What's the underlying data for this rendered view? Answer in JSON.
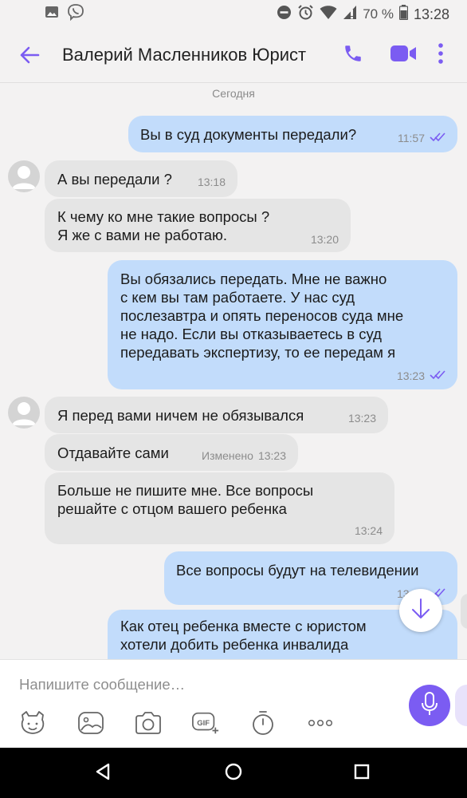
{
  "status_bar": {
    "battery_percent": "70 %",
    "time": "13:28",
    "icons": [
      "gallery-icon",
      "viber-icon",
      "do-not-disturb-icon",
      "alarm-icon",
      "wifi-icon",
      "signal-icon",
      "battery-icon"
    ]
  },
  "header": {
    "contact_name": "Валерий Масленников Юрист",
    "icons": [
      "back-arrow-icon",
      "phone-icon",
      "video-icon",
      "more-vertical-icon"
    ],
    "accent_color": "#7b5cf2"
  },
  "chat": {
    "date_separator": "Сегодня",
    "messages": [
      {
        "direction": "out",
        "text": "Вы в суд документы передали?",
        "time": "11:57",
        "read": true
      },
      {
        "direction": "in",
        "text": "А вы передали ?",
        "time": "13:18",
        "avatar": true
      },
      {
        "direction": "in",
        "text": "К чему ко мне такие вопросы ?\nЯ же с вами не работаю.",
        "time": "13:20"
      },
      {
        "direction": "out",
        "text": "Вы обязались передать. Мне не важно\nс кем вы там работаете. У нас суд\nпослезавтра и опять переносов суда мне\nне надо. Если вы отказываетесь в суд\nпередавать экспертизу, то ее передам я",
        "time": "13:23",
        "read": true
      },
      {
        "direction": "in",
        "text": "Я перед вами ничем не обязывался",
        "time": "13:23",
        "avatar": true
      },
      {
        "direction": "in",
        "text": "Отдавайте сами",
        "time": "13:23",
        "edited_label": "Изменено"
      },
      {
        "direction": "in",
        "text": "Больше не пишите мне. Все вопросы\nрешайте с отцом вашего ребенка",
        "time": "13:24"
      },
      {
        "direction": "out",
        "text": "Все вопросы будут на телевидении",
        "time": "13:25",
        "read": true
      },
      {
        "direction": "out",
        "text": "Как отец ребенка вместе с юристом\nхотели добить ребенка инвалида",
        "time": ""
      }
    ],
    "colors": {
      "outgoing": "#c2dcfb",
      "incoming": "#e5e5e5",
      "read_checks": "#7b5cf2"
    }
  },
  "composer": {
    "placeholder": "Напишите сообщение…",
    "tools": [
      "sticker-icon",
      "gallery-icon",
      "camera-icon",
      "gif-icon",
      "timer-icon",
      "more-horizontal-icon"
    ],
    "mic_icon": "microphone-icon"
  },
  "nav_bar": {
    "buttons": [
      "back-triangle-icon",
      "home-circle-icon",
      "recents-square-icon"
    ]
  }
}
